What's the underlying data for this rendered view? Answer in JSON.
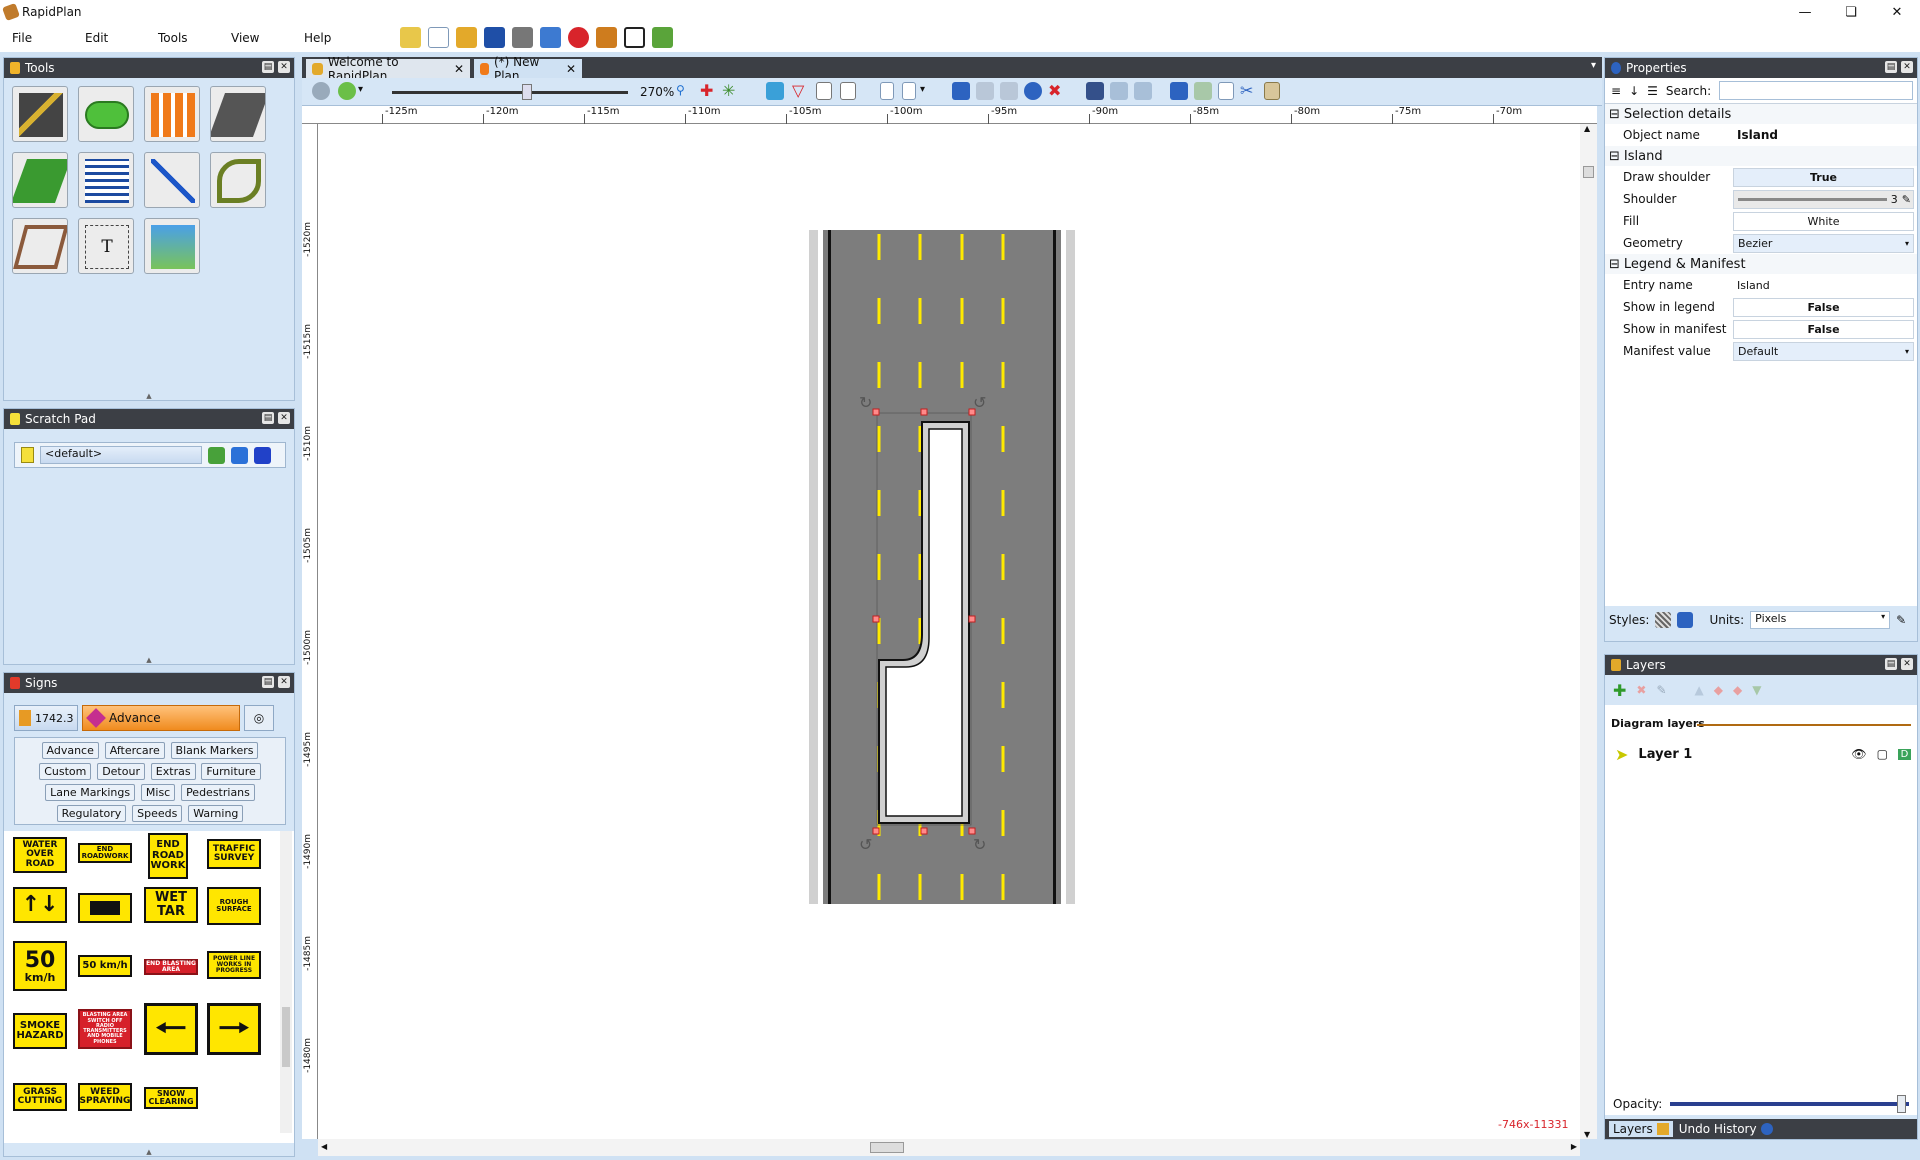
{
  "app": {
    "title": "RapidPlan"
  },
  "menu": [
    "File",
    "Edit",
    "Tools",
    "View",
    "Help"
  ],
  "panels": {
    "tools": "Tools",
    "scratch": "Scratch Pad",
    "signs": "Signs",
    "properties": "Properties",
    "layers": "Layers"
  },
  "scratch": {
    "value": "<default>"
  },
  "signs": {
    "count": "1742.3",
    "category": "Advance",
    "filters": [
      "Advance",
      "Aftercare",
      "Blank Markers",
      "Custom",
      "Detour",
      "Extras",
      "Furniture",
      "Lane Markings",
      "Misc",
      "Pedestrians",
      "Regulatory",
      "Speeds",
      "Warning"
    ],
    "items": {
      "water": "WATER OVER ROAD",
      "end_roadwork": "END ROADWORK",
      "end_road_work": "END ROAD WORK",
      "traffic_survey": "TRAFFIC SURVEY",
      "wet_tar": "WET TAR",
      "rough_surface": "ROUGH SURFACE",
      "speed_big_num": "50",
      "speed_big_unit": "km/h",
      "speed_small": "50 km/h",
      "end_blasting": "END BLASTING AREA",
      "power_line": "POWER LINE WORKS IN PROGRESS",
      "smoke": "SMOKE HAZARD",
      "blasting_area": "BLASTING AREA SWITCH OFF RADIO TRANSMITTERS AND MOBILE PHONES",
      "grass": "GRASS CUTTING",
      "weed": "WEED SPRAYING",
      "snow": "SNOW CLEARING"
    }
  },
  "doc_tabs": [
    "Welcome to RapidPlan",
    "(*) New Plan"
  ],
  "zoom": "270%",
  "ruler_top": [
    "-125m",
    "-120m",
    "-115m",
    "-110m",
    "-105m",
    "-100m",
    "-95m",
    "-90m",
    "-85m",
    "-80m",
    "-75m",
    "-70m"
  ],
  "ruler_left": [
    "-1520m",
    "-1515m",
    "-1510m",
    "-1505m",
    "-1500m",
    "-1495m",
    "-1490m",
    "-1485m",
    "-1480m"
  ],
  "status_coords": "-746x-11331",
  "properties": {
    "search_label": "Search:",
    "section_selection": "Selection details",
    "object_name_label": "Object name",
    "object_name": "Island",
    "section_island": "Island",
    "draw_shoulder_label": "Draw shoulder",
    "draw_shoulder": "True",
    "shoulder_label": "Shoulder",
    "shoulder_value": "3",
    "fill_label": "Fill",
    "fill": "White",
    "geometry_label": "Geometry",
    "geometry": "Bezier",
    "section_legend": "Legend & Manifest",
    "entry_name_label": "Entry name",
    "entry_name": "Island",
    "show_legend_label": "Show in legend",
    "show_legend": "False",
    "show_manifest_label": "Show in manifest",
    "show_manifest": "False",
    "manifest_value_label": "Manifest value",
    "manifest_value": "Default",
    "styles_label": "Styles:",
    "units_label": "Units:",
    "units": "Pixels"
  },
  "layers": {
    "diagram_layers": "Diagram layers",
    "layer_name": "Layer 1",
    "opacity_label": "Opacity:",
    "opacity": 0.97,
    "bottom_tabs": [
      "Layers",
      "Undo History"
    ]
  },
  "colors": {
    "road": "#7d7d7d",
    "lane_line": "#ffea00",
    "panel_header": "#3c3f45",
    "panel_bg": "#d6e6f6"
  }
}
